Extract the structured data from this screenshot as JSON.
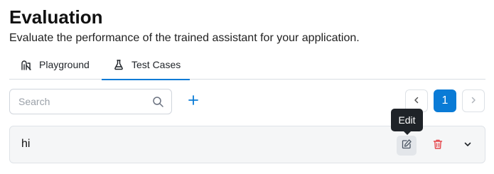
{
  "header": {
    "title": "Evaluation",
    "subtitle": "Evaluate the performance of the trained assistant for your application."
  },
  "tabs": [
    {
      "label": "Playground",
      "icon": "playground-icon",
      "active": false
    },
    {
      "label": "Test Cases",
      "icon": "flask-icon",
      "active": true
    }
  ],
  "toolbar": {
    "search_placeholder": "Search",
    "search_value": "",
    "add_icon": "plus-icon"
  },
  "pagination": {
    "current_page": "1"
  },
  "tooltip": {
    "text": "Edit"
  },
  "test_cases": [
    {
      "title": "hi"
    }
  ],
  "colors": {
    "accent": "#0a7bd6",
    "delete": "#e5484d",
    "tooltip_bg": "#1f2328"
  }
}
